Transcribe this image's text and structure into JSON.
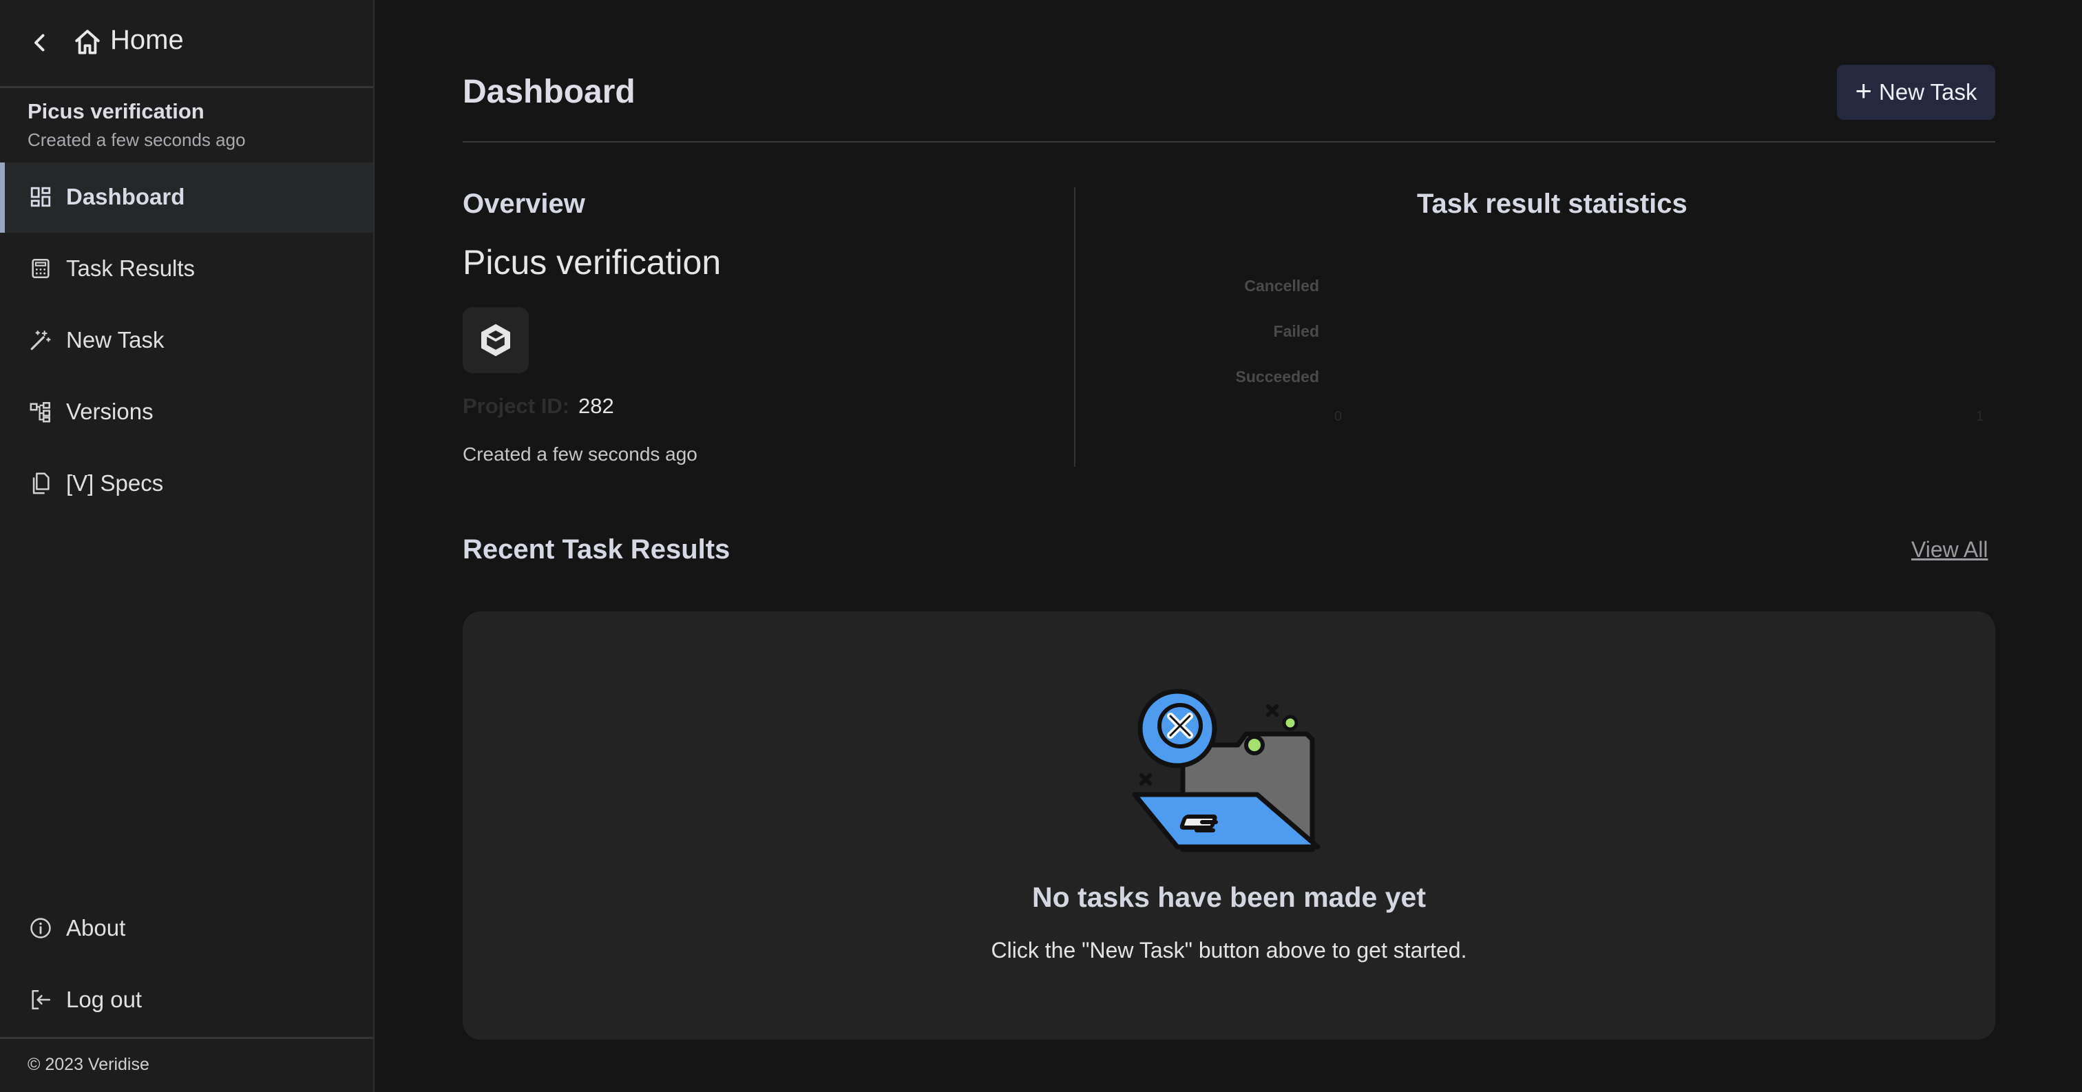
{
  "sidebar": {
    "home_label": "Home",
    "project_name": "Picus verification",
    "project_created": "Created a few seconds ago",
    "nav_items": [
      {
        "label": "Dashboard",
        "icon": "dashboard-icon",
        "active": true
      },
      {
        "label": "Task Results",
        "icon": "calculator-icon",
        "active": false
      },
      {
        "label": "New Task",
        "icon": "magic-wand-icon",
        "active": false
      },
      {
        "label": "Versions",
        "icon": "hierarchy-icon",
        "active": false
      },
      {
        "label": "[V] Specs",
        "icon": "files-icon",
        "active": false
      }
    ],
    "bottom_items": [
      {
        "label": "About",
        "icon": "info-icon"
      },
      {
        "label": "Log out",
        "icon": "logout-icon"
      }
    ],
    "copyright": "© 2023 Veridise"
  },
  "header": {
    "title": "Dashboard",
    "new_task_label": "New Task"
  },
  "overview": {
    "title": "Overview",
    "project_name": "Picus verification",
    "project_id_label": "Project ID:",
    "project_id_value": "282",
    "created": "Created a few seconds ago"
  },
  "stats": {
    "title": "Task result statistics",
    "categories": [
      "Cancelled",
      "Failed",
      "Succeeded"
    ],
    "tick_min": "0",
    "tick_max": "1"
  },
  "recent": {
    "title": "Recent Task Results",
    "view_all_label": "View All",
    "empty_title": "No tasks have been made yet",
    "empty_description": "Click the \"New Task\" button above to get started."
  },
  "colors": {
    "background": "#151515",
    "sidebar": "#1d1d1e",
    "accent_button": "#242940",
    "active_indicator": "#9aa5bf",
    "illustration_blue": "#4d9cf0",
    "illustration_gray": "#6b6b6b",
    "illustration_green": "#a6e070"
  }
}
